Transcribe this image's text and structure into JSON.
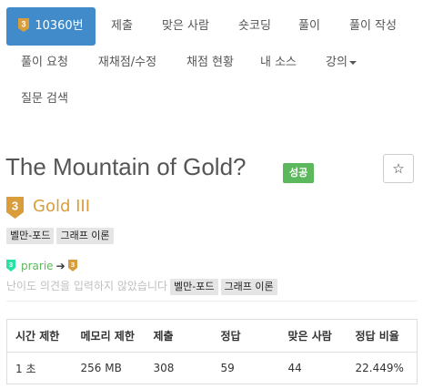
{
  "nav": {
    "problem_number": "10360번",
    "submit": "제출",
    "solved_users": "맞은 사람",
    "short_coding": "숏코딩",
    "solutions": "풀이",
    "write_solution": "풀이 작성",
    "request_solution": "풀이 요청",
    "rejudge": "재채점/수정",
    "judge_status": "채점 현황",
    "my_source": "내 소스",
    "lectures": "강의",
    "search_questions": "질문 검색"
  },
  "problem": {
    "title": "The Mountain of Gold?",
    "result_badge": "성공",
    "star_icon": "☆",
    "tier_icon": "gold-3-tier-icon",
    "tier_level": "3",
    "tier_name": "Gold III",
    "tier_color": "#d99d3c",
    "tags": [
      "벨만-포드",
      "그래프 이론"
    ]
  },
  "contribution": {
    "from_tier_level": "3",
    "user": "prarie",
    "arrow": "➔",
    "to_tier_level": "3",
    "difficulty_placeholder": "난이도 의견을 입력하지 않았습니다",
    "tags": [
      "벨만-포드",
      "그래프 이론"
    ]
  },
  "stats": {
    "headers": [
      "시간 제한",
      "메모리 제한",
      "제출",
      "정답",
      "맞은 사람",
      "정답 비율"
    ],
    "values": [
      "1 초",
      "256 MB",
      "308",
      "59",
      "44",
      "22.449%"
    ]
  },
  "colors": {
    "nav_active": "#428bca",
    "success": "#5cb85c",
    "gold": "#d99d3c",
    "sprout": "#27e2a4"
  }
}
